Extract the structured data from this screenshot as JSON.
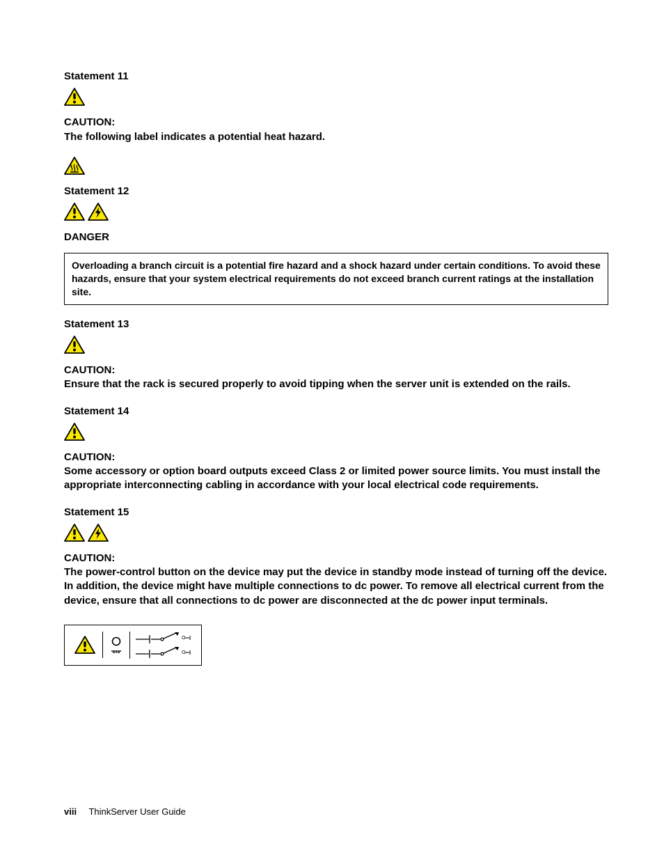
{
  "s11": {
    "heading": "Statement 11",
    "caution_label": "CAUTION:",
    "caution_text": "The following label indicates a potential heat hazard."
  },
  "s12": {
    "heading": "Statement 12",
    "danger_label": "DANGER",
    "danger_text": "Overloading a branch circuit is a potential fire hazard and a shock hazard under certain conditions. To avoid these hazards, ensure that your system electrical requirements do not exceed branch current ratings at the installation site."
  },
  "s13": {
    "heading": "Statement 13",
    "caution_label": "CAUTION:",
    "caution_text": "Ensure that the rack is secured properly to avoid tipping when the server unit is extended on the rails."
  },
  "s14": {
    "heading": "Statement 14",
    "caution_label": "CAUTION:",
    "caution_text": "Some accessory or option board outputs exceed Class 2 or limited power source limits. You must install the appropriate interconnecting cabling in accordance with your local electrical code requirements."
  },
  "s15": {
    "heading": "Statement 15",
    "caution_label": "CAUTION:",
    "caution_text": "The power-control button on the device may put the device in standby mode instead of turning off the device. In addition, the device might have multiple connections to dc power. To remove all electrical current from the device, ensure that all connections to dc power are disconnected at the dc power input terminals."
  },
  "footer": {
    "pagenum": "viii",
    "title": "ThinkServer User Guide"
  }
}
